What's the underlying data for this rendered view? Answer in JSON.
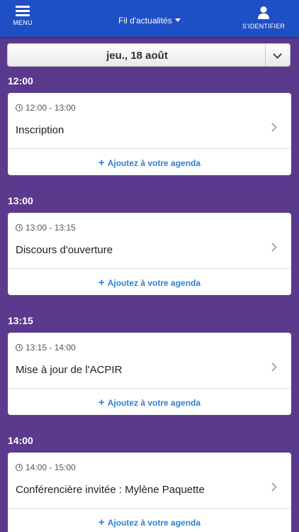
{
  "header": {
    "menu_label": "MENU",
    "title": "Fil d'actualités",
    "login_label": "S'IDENTIFIER",
    "bar_color": "#1e4fc4"
  },
  "date_selector": {
    "value": "jeu., 18 août"
  },
  "add_label": "Ajoutez à votre agenda",
  "sessions": [
    {
      "header": "12:00",
      "time": "12:00 - 13:00",
      "title": "Inscription"
    },
    {
      "header": "13:00",
      "time": "13:00 - 13:15",
      "title": "Discours d'ouverture"
    },
    {
      "header": "13:15",
      "time": "13:15 - 14:00",
      "title": "Mise à jour de l'ACPIR"
    },
    {
      "header": "14:00",
      "time": "14:00 - 15:00",
      "title": "Conférencière invitée : Mylène Paquette"
    }
  ],
  "colors": {
    "background": "#5b3a8e",
    "link": "#2f7fcf"
  },
  "icons": [
    "hamburger-icon",
    "caret-down-icon",
    "user-icon",
    "chevron-down-icon",
    "clock-icon",
    "chevron-right-icon",
    "plus-icon"
  ]
}
